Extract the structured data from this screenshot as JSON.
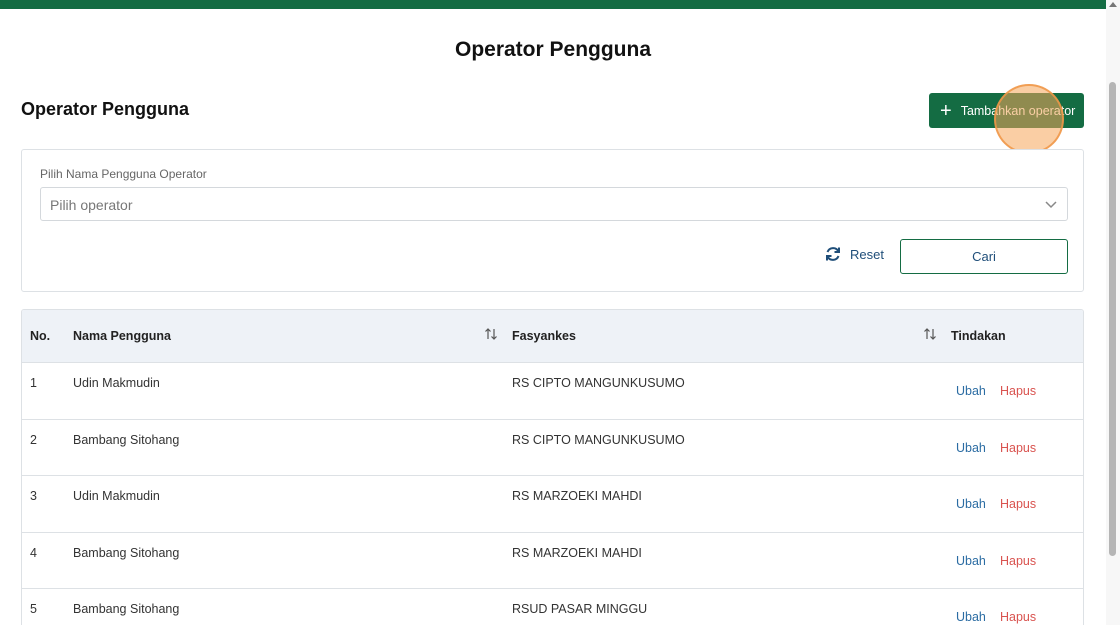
{
  "header": {
    "page_title": "Operator Pengguna"
  },
  "section": {
    "title": "Operator Pengguna",
    "add_button_label": "Tambahkan operator",
    "add_button_icon": "plus-icon"
  },
  "filter": {
    "label": "Pilih Nama Pengguna Operator",
    "select_placeholder": "Pilih operator",
    "reset_label": "Reset",
    "search_label": "Cari"
  },
  "table": {
    "columns": {
      "no": "No.",
      "name": "Nama Pengguna",
      "facility": "Fasyankes",
      "actions": "Tindakan"
    },
    "rows": [
      {
        "no": "1",
        "name": "Udin Makmudin",
        "facility": "RS CIPTO MANGUNKUSUMO",
        "edit": "Ubah",
        "delete": "Hapus"
      },
      {
        "no": "2",
        "name": "Bambang Sitohang",
        "facility": "RS CIPTO MANGUNKUSUMO",
        "edit": "Ubah",
        "delete": "Hapus"
      },
      {
        "no": "3",
        "name": "Udin Makmudin",
        "facility": "RS MARZOEKI MAHDI",
        "edit": "Ubah",
        "delete": "Hapus"
      },
      {
        "no": "4",
        "name": "Bambang Sitohang",
        "facility": "RS MARZOEKI MAHDI",
        "edit": "Ubah",
        "delete": "Hapus"
      },
      {
        "no": "5",
        "name": "Bambang Sitohang",
        "facility": "RSUD PASAR MINGGU",
        "edit": "Ubah",
        "delete": "Hapus"
      }
    ]
  },
  "colors": {
    "brand_green": "#146c43",
    "link_blue": "#2b6ca3",
    "delete_red": "#d9534f",
    "header_bg": "#eef2f7"
  }
}
